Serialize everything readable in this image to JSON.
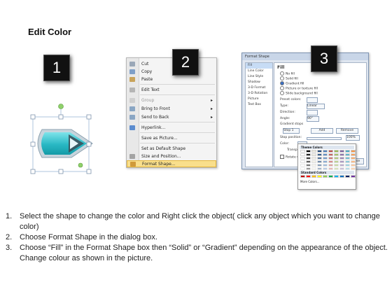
{
  "title": "Edit Color",
  "steps": {
    "one": "1",
    "two": "2",
    "three": "3"
  },
  "context_menu": {
    "items": [
      {
        "label": "Cut",
        "dim": false,
        "arrow": false,
        "icon": "scissors-icon"
      },
      {
        "label": "Copy",
        "dim": false,
        "arrow": false,
        "icon": "copy-icon"
      },
      {
        "label": "Paste",
        "dim": false,
        "arrow": false,
        "icon": "paste-icon"
      },
      {
        "label": "Edit Text",
        "dim": false,
        "arrow": false,
        "icon": "edit-text-icon"
      },
      {
        "label": "Group",
        "dim": true,
        "arrow": true,
        "icon": "group-icon"
      },
      {
        "label": "Bring to Front",
        "dim": false,
        "arrow": true,
        "icon": "bring-front-icon"
      },
      {
        "label": "Send to Back",
        "dim": false,
        "arrow": true,
        "icon": "send-back-icon"
      },
      {
        "label": "Hyperlink...",
        "dim": false,
        "arrow": false,
        "icon": "hyperlink-icon"
      },
      {
        "label": "Save as Picture...",
        "dim": false,
        "arrow": false,
        "icon": ""
      },
      {
        "label": "Set as Default Shape",
        "dim": false,
        "arrow": false,
        "icon": ""
      },
      {
        "label": "Size and Position...",
        "dim": false,
        "arrow": false,
        "icon": "size-icon"
      },
      {
        "label": "Format Shape...",
        "dim": false,
        "arrow": false,
        "icon": "format-shape-icon",
        "highlight": true
      }
    ]
  },
  "format_dialog": {
    "title": "Format Shape",
    "buttons": [
      "?",
      "x"
    ],
    "left_items": [
      "Fill",
      "Line Color",
      "Line Style",
      "Shadow",
      "3-D Format",
      "3-D Rotation",
      "Picture",
      "Text Box"
    ],
    "fill_heading": "Fill",
    "options": [
      "No fill",
      "Solid fill",
      "Gradient fill",
      "Picture or texture fill",
      "Slide background fill"
    ],
    "fields": {
      "preset": "Preset colors:",
      "type": "Type:",
      "type_value": "Linear",
      "direction": "Direction:",
      "angle": "Angle:",
      "angle_value": "90°",
      "gradient_stops": "Gradient stops",
      "stop": "Stop 1",
      "add": "Add",
      "remove": "Remove",
      "stop_position": "Stop position:",
      "stop_pct": "100%",
      "color": "Color:",
      "transparency": "Transparency:",
      "rotate": "Rotate with shape",
      "close": "Close"
    }
  },
  "palette": {
    "theme_label": "Theme Colors",
    "standard_label": "Standard Colors",
    "more_label": "More Colors..."
  },
  "instructions": [
    {
      "n": "1.",
      "text": "Select the shape to change the color and Right click the object( click any object which you want to change color)"
    },
    {
      "n": "2.",
      "text": "Choose Format Shape in the dialog box."
    },
    {
      "n": "3.",
      "text": "Choose “Fill” in the Format Shape box then “Solid” or “Gradient” depending on the appearance of the object. Change colour as shown in the picture."
    }
  ]
}
